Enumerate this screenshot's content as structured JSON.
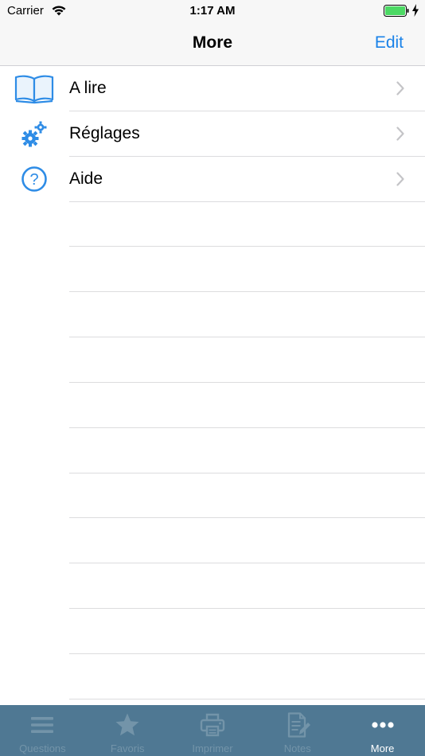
{
  "status_bar": {
    "carrier": "Carrier",
    "time": "1:17 AM"
  },
  "nav": {
    "title": "More",
    "edit_label": "Edit"
  },
  "list": {
    "items": [
      {
        "label": "A lire",
        "icon": "book-icon"
      },
      {
        "label": "Réglages",
        "icon": "gears-icon"
      },
      {
        "label": "Aide",
        "icon": "help-icon"
      }
    ]
  },
  "tab_bar": {
    "items": [
      {
        "label": "Questions",
        "icon": "list-icon",
        "active": false
      },
      {
        "label": "Favoris",
        "icon": "star-icon",
        "active": false
      },
      {
        "label": "Imprimer",
        "icon": "printer-icon",
        "active": false
      },
      {
        "label": "Notes",
        "icon": "notes-icon",
        "active": false
      },
      {
        "label": "More",
        "icon": "more-icon",
        "active": true
      }
    ]
  },
  "colors": {
    "accent": "#1a82e8",
    "icon_blue": "#2e8ce6",
    "tab_bar_bg": "#4f7893",
    "tab_inactive": "#7394a9",
    "tab_active": "#ffffff",
    "battery": "#4cd964"
  }
}
